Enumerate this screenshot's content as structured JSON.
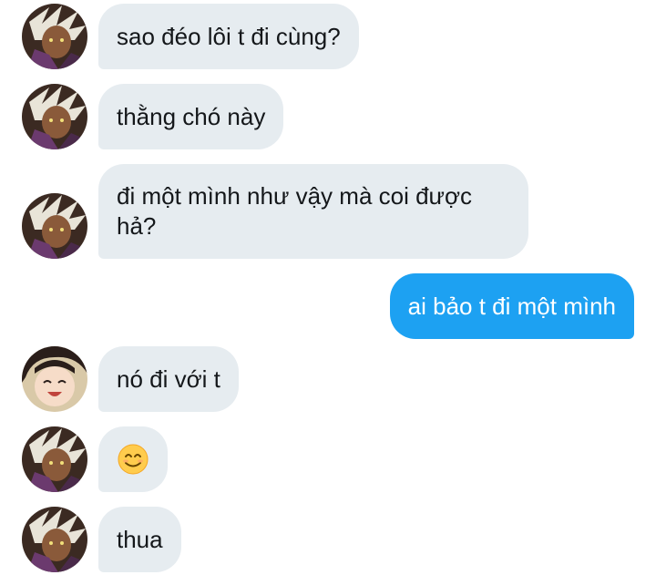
{
  "messages": [
    {
      "side": "in",
      "avatar": "dark-hair-avatar",
      "text": "sao đéo lôi t đi cùng?"
    },
    {
      "side": "in",
      "avatar": "dark-hair-avatar",
      "text": "thằng chó này"
    },
    {
      "side": "in",
      "avatar": "dark-hair-avatar",
      "text": "đi một mình như vậy mà coi được hả?"
    },
    {
      "side": "out",
      "text": "ai bảo t đi một mình"
    },
    {
      "side": "in",
      "avatar": "smiling-girl-avatar",
      "text": "nó đi với t"
    },
    {
      "side": "in",
      "avatar": "dark-hair-avatar",
      "emoji": "smiling-face-emoji"
    },
    {
      "side": "in",
      "avatar": "dark-hair-avatar",
      "text": "thua"
    }
  ],
  "colors": {
    "incoming_bubble": "#e6ecf0",
    "outgoing_bubble": "#1da1f2",
    "text": "#14171a",
    "outgoing_text": "#ffffff"
  }
}
